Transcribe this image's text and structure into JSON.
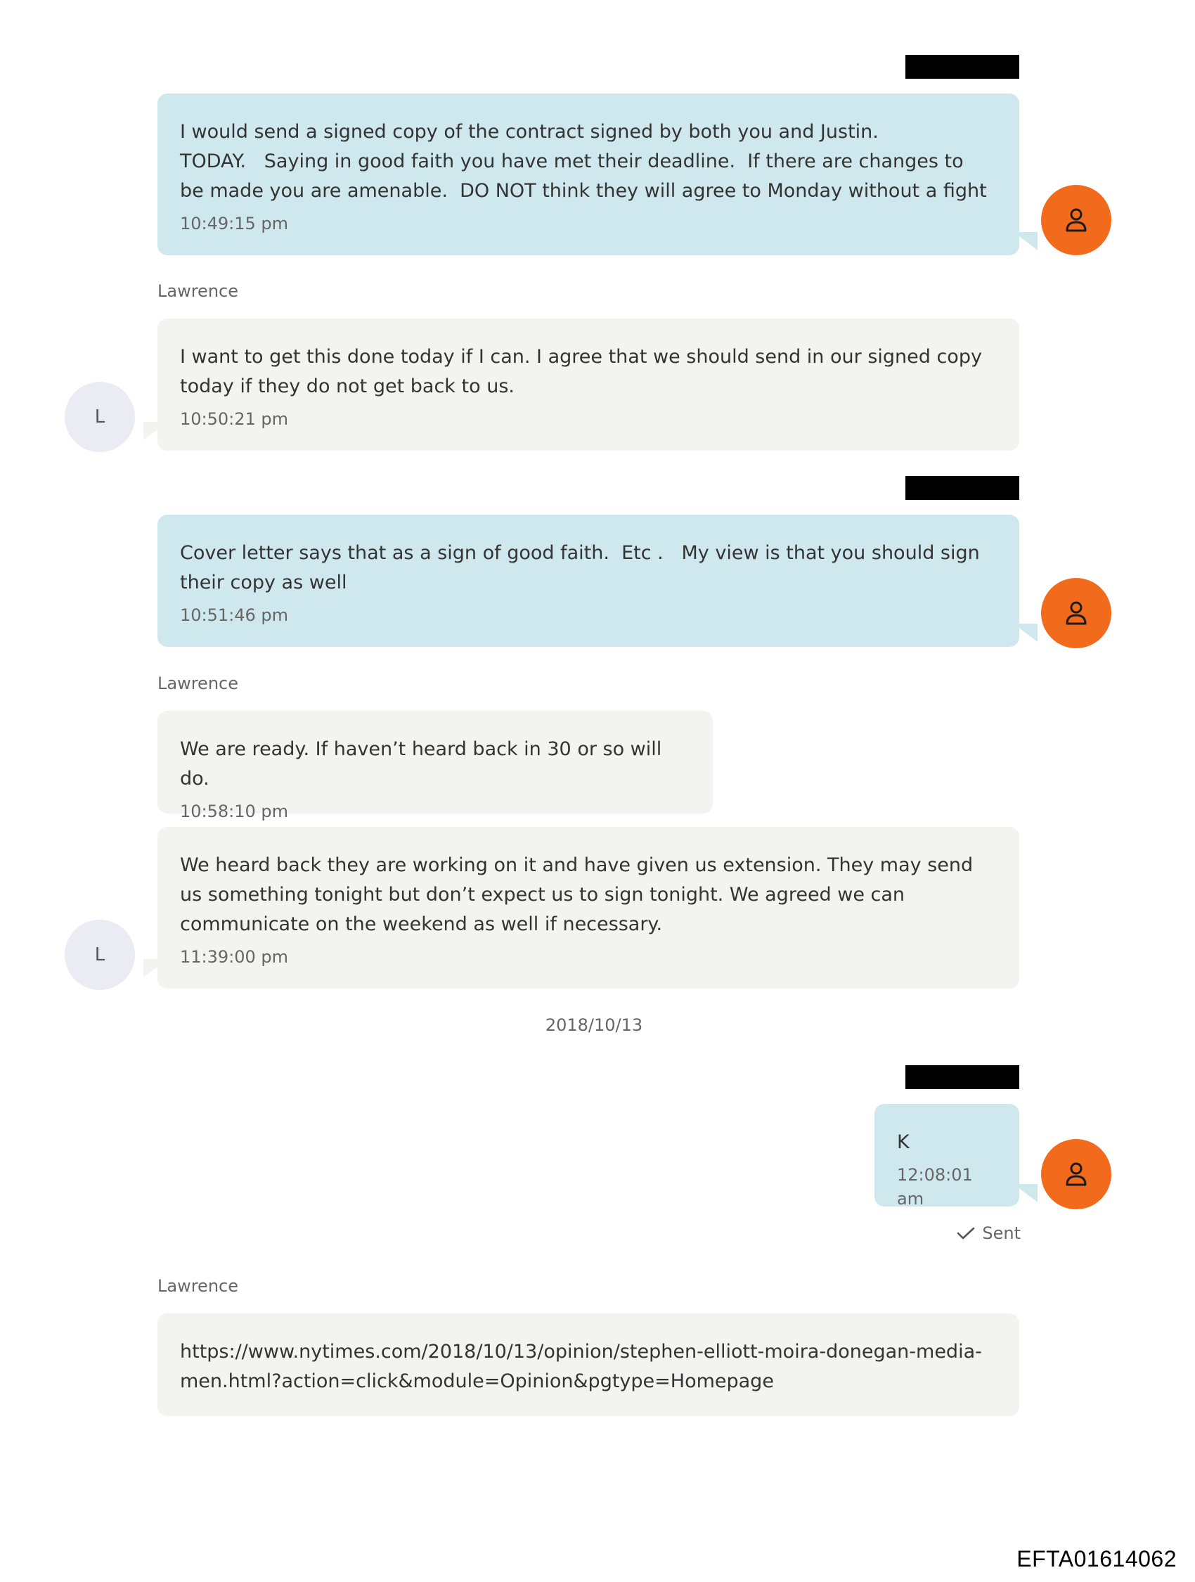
{
  "messages": [
    {
      "direction": "out",
      "text": "I would send a signed copy of the contract signed by both you and Justin.\nTODAY.   Saying in good faith you have met their deadline.  If there are changes to be made you are amenable.  DO NOT think they will agree to Monday without a fight",
      "time": "10:49:15 pm"
    },
    {
      "direction": "in",
      "sender": "Lawrence",
      "avatar_letter": "L",
      "text": "I want to get this done today if I can. I agree that we should send in our signed copy today if they do not get back to us.",
      "time": "10:50:21 pm"
    },
    {
      "direction": "out",
      "text": "Cover letter says that as a sign of good faith.  Etc .   My view is that you should sign their copy as well",
      "time": "10:51:46 pm"
    },
    {
      "direction": "in",
      "sender": "Lawrence",
      "text": "We are ready. If haven’t heard back in 30 or so will do.",
      "time": "10:58:10 pm"
    },
    {
      "direction": "in",
      "avatar_letter": "L",
      "text": "We heard back they are working on it and have given us extension. They may send us something tonight but don’t expect us to sign tonight. We agreed we can communicate on the weekend as well if necessary.",
      "time": "11:39:00 pm"
    },
    {
      "direction": "out",
      "text": "K",
      "time": "12:08:01 am",
      "status": "Sent"
    },
    {
      "direction": "in",
      "sender": "Lawrence",
      "text": "https://www.nytimes.com/2018/10/13/opinion/stephen-elliott-moira-donegan-media-men.html?action=click&module=Opinion&pgtype=Homepage"
    }
  ],
  "date_separator": "2018/10/13",
  "document_id": "EFTA01614062",
  "colors": {
    "outgoing_bubble": "#cfe8ee",
    "incoming_bubble": "#f3f3f0",
    "user_avatar": "#f26b1d",
    "contact_avatar": "#ebebf3"
  },
  "icons": {
    "user_avatar": "person-icon",
    "status": "checkmark-icon"
  }
}
